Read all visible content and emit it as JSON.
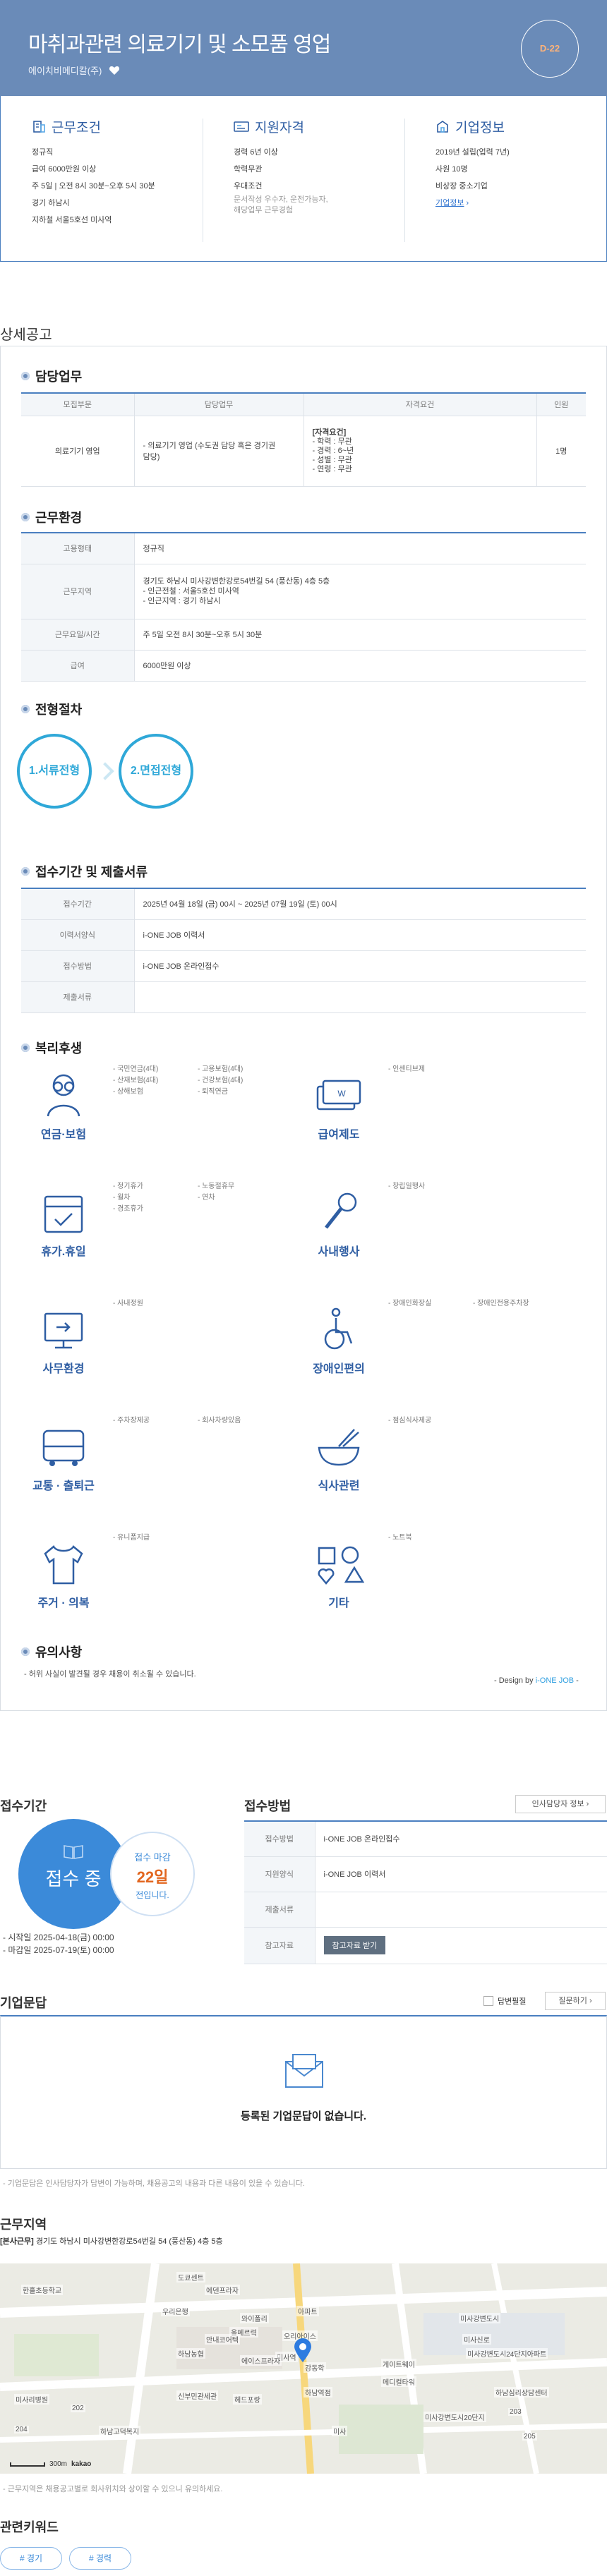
{
  "header": {
    "title": "마취과관련 의료기기 및 소모품 영업",
    "company": "에이치비메디칼(주)",
    "dday": "D-22"
  },
  "summary": {
    "work": {
      "title": "근무조건",
      "items": [
        "정규직",
        "급여 6000만원 이상",
        "주 5일 | 오전 8시 30분~오후 5시 30분",
        "경기 하남시",
        "지하철 서울5호선 미사역"
      ]
    },
    "qualification": {
      "title": "지원자격",
      "items": [
        "경력 6년 이상",
        "학력무관",
        "우대조건"
      ],
      "sub": [
        "문서작성 우수자, 운전가능자,",
        "해당업무 근무경험"
      ]
    },
    "company": {
      "title": "기업정보",
      "items": [
        "2019년 설립(업력 7년)",
        "사원 10명",
        "비상장 중소기업"
      ],
      "link": "기업정보"
    }
  },
  "detail_title": "상세공고",
  "duty": {
    "title": "담당업무",
    "headers": [
      "모집부문",
      "담당업무",
      "자격요건",
      "인원"
    ],
    "row": {
      "part": "의료기기 영업",
      "task_lines": [
        "- 의료기기 영업 (수도권 담당 혹은 경기권",
        "담당)"
      ],
      "req_head": "[자격요건]",
      "req_lines": [
        "- 학력 : 무관",
        "- 경력 : 6~년",
        "- 성별 : 무관",
        "- 연령 : 무관"
      ],
      "count": "1명"
    }
  },
  "env": {
    "title": "근무환경",
    "rows": [
      {
        "label": "고용형태",
        "lines": [
          "정규직"
        ]
      },
      {
        "label": "근무지역",
        "lines": [
          "경기도 하남시 미사강변한강로54번길 54 (풍산동) 4층 5층",
          "- 인근전철 : 서울5호선 미사역",
          "- 인근지역 : 경기 하남시"
        ]
      },
      {
        "label": "근무요일/시간",
        "lines": [
          "주 5일 오전 8시 30분~오후 5시 30분"
        ]
      },
      {
        "label": "급여",
        "lines": [
          "6000만원 이상"
        ]
      }
    ]
  },
  "process": {
    "title": "전형절차",
    "steps": [
      "1.서류전형",
      "2.면접전형"
    ]
  },
  "apply": {
    "title": "접수기간 및 제출서류",
    "rows": [
      {
        "label": "접수기간",
        "value": "2025년 04월 18일 (금) 00시 ~ 2025년 07월 19일 (토) 00시"
      },
      {
        "label": "이력서양식",
        "value": "i-ONE JOB 이력서"
      },
      {
        "label": "접수방법",
        "value": "i-ONE JOB 온라인접수"
      },
      {
        "label": "제출서류",
        "value": ""
      }
    ]
  },
  "welfare": {
    "title": "복리후생",
    "groups": [
      {
        "label": "연금·보험",
        "icon": "glasses-person-icon",
        "cols": [
          [
            "- 국민연금(4대)",
            "- 산재보험(4대)",
            "- 상해보험"
          ],
          [
            "- 고용보험(4대)",
            "- 건강보험(4대)",
            "- 퇴직연금"
          ]
        ]
      },
      {
        "label": "급여제도",
        "icon": "money-cards-icon",
        "cols": [
          [
            "- 인센티브제"
          ]
        ]
      },
      {
        "label": "휴가.휴일",
        "icon": "calendar-icon",
        "cols": [
          [
            "- 정기휴가",
            "- 월차",
            "- 경조휴가"
          ],
          [
            "- 노동절휴무",
            "- 연차"
          ]
        ]
      },
      {
        "label": "사내행사",
        "icon": "microphone-icon",
        "cols": [
          [
            "- 창립일행사"
          ]
        ]
      },
      {
        "label": "사무환경",
        "icon": "monitor-icon",
        "cols": [
          [
            "- 사내정원"
          ]
        ]
      },
      {
        "label": "장애인편의",
        "icon": "wheelchair-icon",
        "cols": [
          [
            "- 장애인화장실"
          ],
          [
            "- 장애인전용주차장"
          ]
        ]
      },
      {
        "label": "교통 · 출퇴근",
        "icon": "bus-icon",
        "cols": [
          [
            "- 주차장제공"
          ],
          [
            "- 회사차량있음"
          ]
        ]
      },
      {
        "label": "식사관련",
        "icon": "bowl-icon",
        "cols": [
          [
            "- 점심식사제공"
          ]
        ]
      },
      {
        "label": "주거 · 의복",
        "icon": "shirt-icon",
        "cols": [
          [
            "- 유니폼지급"
          ]
        ]
      },
      {
        "label": "기타",
        "icon": "shapes-icon",
        "cols": [
          [
            "- 노트북"
          ]
        ]
      }
    ]
  },
  "caution": {
    "title": "유의사항",
    "text": "- 허위 사실이 발견될 경우 채용이 취소될 수 있습니다.",
    "design_prefix": "- Design by ",
    "design_brand": "i-ONE JOB",
    "design_suffix": " -"
  },
  "period": {
    "title": "접수기간",
    "status": "접수 중",
    "remain_label": "접수 마감",
    "remain_days": "22일",
    "remain_suffix": "전입니다.",
    "start": "- 시작일 2025-04-18(금) 00:00",
    "end": "- 마감일 2025-07-19(토) 00:00"
  },
  "method": {
    "title": "접수방법",
    "manager_button": "인사담당자 정보",
    "rows": [
      {
        "label": "접수방법",
        "value": "i-ONE JOB 온라인접수"
      },
      {
        "label": "지원양식",
        "value": "i-ONE JOB 이력서"
      },
      {
        "label": "제출서류",
        "value": ""
      },
      {
        "label": "참고자료",
        "value": ""
      }
    ],
    "ref_button": "참고자료 받기"
  },
  "qna": {
    "title": "기업문답",
    "answered_label": "답변필질",
    "ask_button": "질문하기",
    "empty": "등록된 기업문답이 없습니다.",
    "note": "- 기업문답은 인사담당자가 답변이 가능하며, 채용공고의 내용과 다른 내용이 있을 수 있습니다."
  },
  "location": {
    "title": "근무지역",
    "label": "[본사근무]",
    "address": "경기도 하남시 미사강변한강로54번길 54 (풍산동) 4층 5층",
    "note": "- 근무지역은 채용공고별로 회사위치와 상이할 수 있으니 유의하세요.",
    "map_labels": [
      "한홀초등학교",
      "도쿄센트",
      "에덴프라자",
      "우리은행",
      "아파트",
      "와이폴리",
      "울메르력",
      "오리아이스",
      "미사역",
      "안내코어텍",
      "하남농협",
      "에이스프라자",
      "강동학",
      "미사강변도시",
      "미사신로",
      "미사리병원",
      "신부민관세관",
      "헤드포랑",
      "하남역점",
      "하남고덕복지",
      "미사강변도시24단지아파트",
      "게이트웨이",
      "메디컬타워",
      "미사",
      "미사강변도시20단지",
      "하남심리상담센터",
      "202",
      "203",
      "204",
      "205"
    ],
    "scale_label": "300m",
    "map_brand": "kakao"
  },
  "keywords": {
    "title": "관련키워드",
    "items": [
      "# 경기",
      "# 경력"
    ]
  }
}
